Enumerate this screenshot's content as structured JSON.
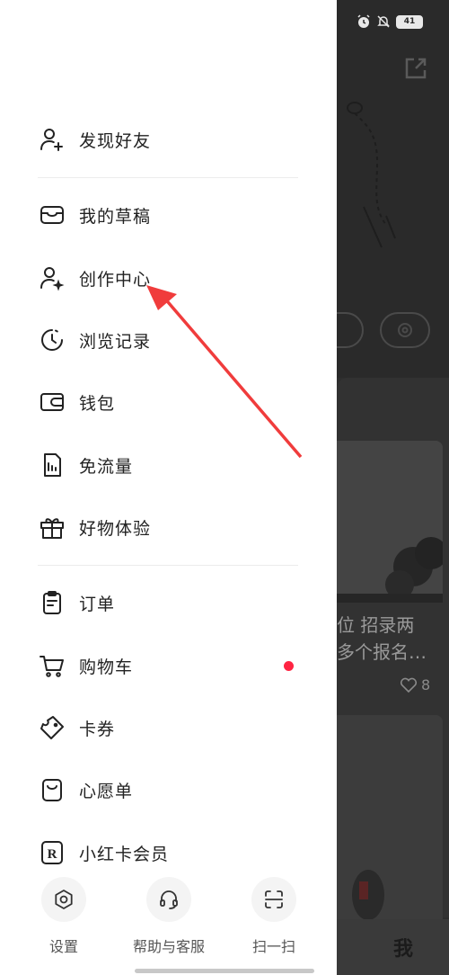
{
  "status_bar": {
    "battery": "41"
  },
  "background": {
    "card_title_line1": "位 招录两",
    "card_title_line2": "多个报名…",
    "card_likes": "8",
    "tab_me": "我"
  },
  "drawer": {
    "items": [
      {
        "label": "发现好友",
        "icon": "add-friend-icon"
      },
      {
        "label": "我的草稿",
        "icon": "inbox-tray-icon"
      },
      {
        "label": "创作中心",
        "icon": "creator-star-icon"
      },
      {
        "label": "浏览记录",
        "icon": "history-clock-icon"
      },
      {
        "label": "钱包",
        "icon": "wallet-icon"
      },
      {
        "label": "免流量",
        "icon": "data-sim-icon"
      },
      {
        "label": "好物体验",
        "icon": "gift-box-icon"
      },
      {
        "label": "订单",
        "icon": "clipboard-order-icon"
      },
      {
        "label": "购物车",
        "icon": "shopping-cart-icon"
      },
      {
        "label": "卡券",
        "icon": "coupon-tag-icon"
      },
      {
        "label": "心愿单",
        "icon": "wishlist-bag-icon"
      },
      {
        "label": "小红卡会员",
        "icon": "r-card-icon"
      }
    ],
    "cart_badge_color": "#ff2442",
    "bottom": {
      "settings": "设置",
      "help": "帮助与客服",
      "scan": "扫一扫"
    }
  },
  "annotation": {
    "arrow_color": "#f03c3c"
  }
}
